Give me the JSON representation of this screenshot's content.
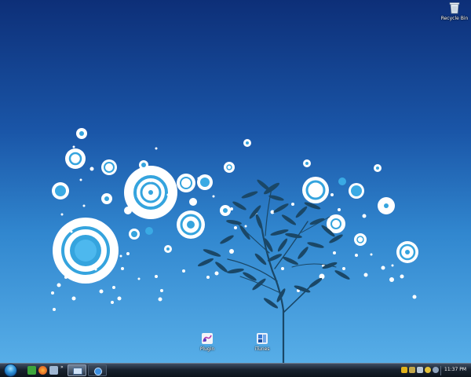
{
  "desktop": {
    "icons": [
      {
        "id": "recycle-bin",
        "label": "Recycle Bin"
      },
      {
        "id": "plugin",
        "label": "Plugin"
      },
      {
        "id": "itunes",
        "label": "iTunes"
      }
    ]
  },
  "taskbar": {
    "clock": "11:37 PM",
    "quick_launch": [
      "utorrent-icon",
      "firefox-icon",
      "show-desktop-icon"
    ],
    "open_windows": [
      "window-icon",
      "ie-icon"
    ],
    "tray": [
      "shield-icon",
      "network-icon",
      "volume-icon",
      "messenger-icon",
      "update-icon"
    ]
  },
  "colors": {
    "sky_top": "#0d2f78",
    "sky_bottom": "#5bb2ea",
    "ring_accent": "#35a4de",
    "tree": "#1a4767"
  }
}
